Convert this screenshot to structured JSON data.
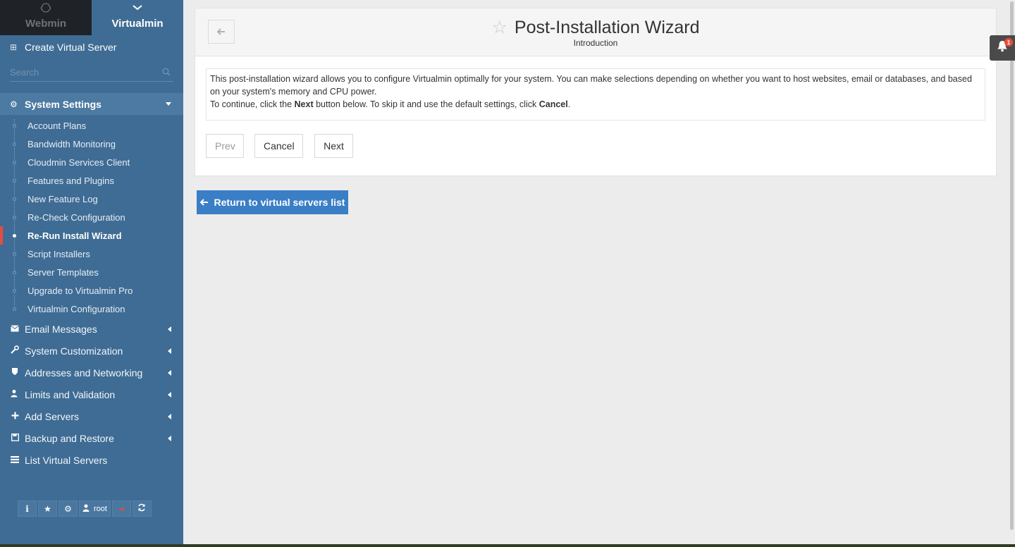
{
  "switcher": {
    "webmin_label": "Webmin",
    "virtualmin_label": "Virtualmin"
  },
  "sidebar": {
    "create_label": "Create Virtual Server",
    "search_placeholder": "Search",
    "open_section": {
      "label": "System Settings",
      "items": [
        {
          "label": "Account Plans"
        },
        {
          "label": "Bandwidth Monitoring"
        },
        {
          "label": "Cloudmin Services Client"
        },
        {
          "label": "Features and Plugins"
        },
        {
          "label": "New Feature Log"
        },
        {
          "label": "Re-Check Configuration"
        },
        {
          "label": "Re-Run Install Wizard",
          "active": true
        },
        {
          "label": "Script Installers"
        },
        {
          "label": "Server Templates"
        },
        {
          "label": "Upgrade to Virtualmin Pro"
        },
        {
          "label": "Virtualmin Configuration"
        }
      ]
    },
    "categories": [
      {
        "label": "Email Messages",
        "icon": "envelope-icon"
      },
      {
        "label": "System Customization",
        "icon": "wrench-icon"
      },
      {
        "label": "Addresses and Networking",
        "icon": "shield-icon"
      },
      {
        "label": "Limits and Validation",
        "icon": "user-lock-icon"
      },
      {
        "label": "Add Servers",
        "icon": "plus-icon"
      },
      {
        "label": "Backup and Restore",
        "icon": "floppy-icon"
      },
      {
        "label": "List Virtual Servers",
        "icon": "list-icon"
      }
    ],
    "bottom_user": "root"
  },
  "main": {
    "title": "Post-Installation Wizard",
    "subtitle": "Introduction",
    "intro": {
      "line1": "This post-installation wizard allows you to configure Virtualmin optimally for your system. You can make selections depending on whether you want to host websites, email or databases, and based on your system's memory and CPU power.",
      "line2_prefix": "To continue, click the ",
      "line2_next": "Next",
      "line2_mid": " button below. To skip it and use the default settings, click ",
      "line2_cancel": "Cancel",
      "line2_suffix": "."
    },
    "buttons": {
      "prev": "Prev",
      "cancel": "Cancel",
      "next": "Next"
    },
    "return_label": "Return to virtual servers list"
  },
  "notifications": {
    "count": "1"
  },
  "colors": {
    "sidebar": "#3f6c94",
    "active_marker": "#e74c3c",
    "primary_button": "#3a7ec6"
  }
}
